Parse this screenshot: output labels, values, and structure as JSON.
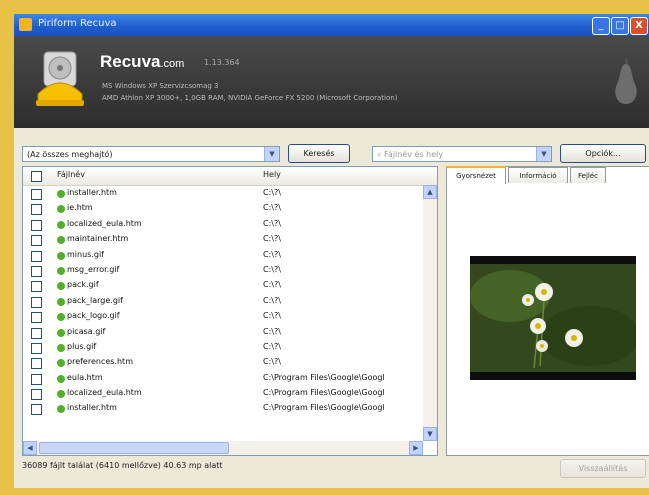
{
  "window": {
    "title": "Piriform Recuva",
    "buttons": {
      "minimize": "_",
      "maximize": "□",
      "close": "X"
    }
  },
  "header": {
    "brand": "Recuva",
    "brand_domain": ".com",
    "version": "1.13.364",
    "sys_line_1": "MS Windows XP Szervizcsomag 3",
    "sys_line_2": "AMD Athlon XP 3000+, 1,0GB RAM, NVIDIA GeForce FX 5200 (Microsoft Corporation)"
  },
  "toolbar": {
    "drive_select": "(Az összes meghajtó)",
    "scan_button": "Keresés",
    "filename_placeholder": "Fájlnév és hely",
    "options_button": "Opciók..."
  },
  "list": {
    "columns": {
      "name": "Fájlnév",
      "path": "Hely"
    },
    "rows": [
      {
        "name": "installer.htm",
        "path": "C:\\?\\"
      },
      {
        "name": "ie.htm",
        "path": "C:\\?\\"
      },
      {
        "name": "localized_eula.htm",
        "path": "C:\\?\\"
      },
      {
        "name": "maintainer.htm",
        "path": "C:\\?\\"
      },
      {
        "name": "minus.gif",
        "path": "C:\\?\\"
      },
      {
        "name": "msg_error.gif",
        "path": "C:\\?\\"
      },
      {
        "name": "pack.gif",
        "path": "C:\\?\\"
      },
      {
        "name": "pack_large.gif",
        "path": "C:\\?\\"
      },
      {
        "name": "pack_logo.gif",
        "path": "C:\\?\\"
      },
      {
        "name": "picasa.gif",
        "path": "C:\\?\\"
      },
      {
        "name": "plus.gif",
        "path": "C:\\?\\"
      },
      {
        "name": "preferences.htm",
        "path": "C:\\?\\"
      },
      {
        "name": "eula.htm",
        "path": "C:\\Program Files\\Google\\Googl"
      },
      {
        "name": "localized_eula.htm",
        "path": "C:\\Program Files\\Google\\Googl"
      },
      {
        "name": "installer.htm",
        "path": "C:\\Program Files\\Google\\Googl"
      }
    ]
  },
  "preview": {
    "tabs": [
      "Gyorsnézet",
      "Információ",
      "Fejléc"
    ],
    "active_tab": 0
  },
  "status": {
    "text": "36089 fájlt találat (6410 mellőzve) 40.63 mp alatt",
    "recover_button": "Visszaállítás"
  },
  "colors": {
    "title_bar": "#1f5ccc",
    "header_bg": "#2d2d2d",
    "status_dot": "#53b02b",
    "frame": "#e8c247"
  }
}
